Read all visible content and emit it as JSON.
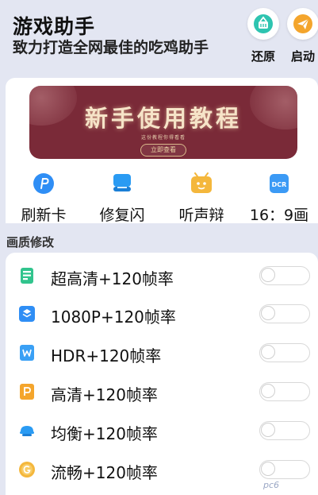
{
  "header": {
    "title": "游戏助手",
    "subtitle": "致力打造全网最佳的吃鸡助手",
    "restore_label": "还原",
    "launch_label": "启动"
  },
  "banner": {
    "title": "新手使用教程",
    "subtitle": "这份教程你得看看",
    "button_label": "立即查看"
  },
  "quick_actions": [
    {
      "label": "刷新卡",
      "icon": "refresh-p-icon",
      "color": "#2f8ef5"
    },
    {
      "label": "修复闪",
      "icon": "repair-layers-icon",
      "color": "#2a9bf3"
    },
    {
      "label": "听声辩",
      "icon": "sound-tv-icon",
      "color": "#f4b73c"
    },
    {
      "label": "16：9画",
      "icon": "dcr-icon",
      "color": "#3b9af5"
    }
  ],
  "section": {
    "title": "画质修改"
  },
  "quality_options": [
    {
      "label": "超高清+120帧率",
      "icon": "sheet-icon",
      "color": "#31c48d",
      "enabled": false
    },
    {
      "label": "1080P+120帧率",
      "icon": "layers-icon",
      "color": "#2f8ef5",
      "enabled": false
    },
    {
      "label": "HDR+120帧率",
      "icon": "w-doc-icon",
      "color": "#3aa0f5",
      "enabled": false
    },
    {
      "label": "高清+120帧率",
      "icon": "p-doc-icon",
      "color": "#f4a52c",
      "enabled": false
    },
    {
      "label": "均衡+120帧率",
      "icon": "cloud-icon",
      "color": "#2a9bf3",
      "enabled": false
    },
    {
      "label": "流畅+120帧率",
      "icon": "g-coin-icon",
      "color": "#f4b73c",
      "enabled": false
    }
  ],
  "watermark": "pc6"
}
